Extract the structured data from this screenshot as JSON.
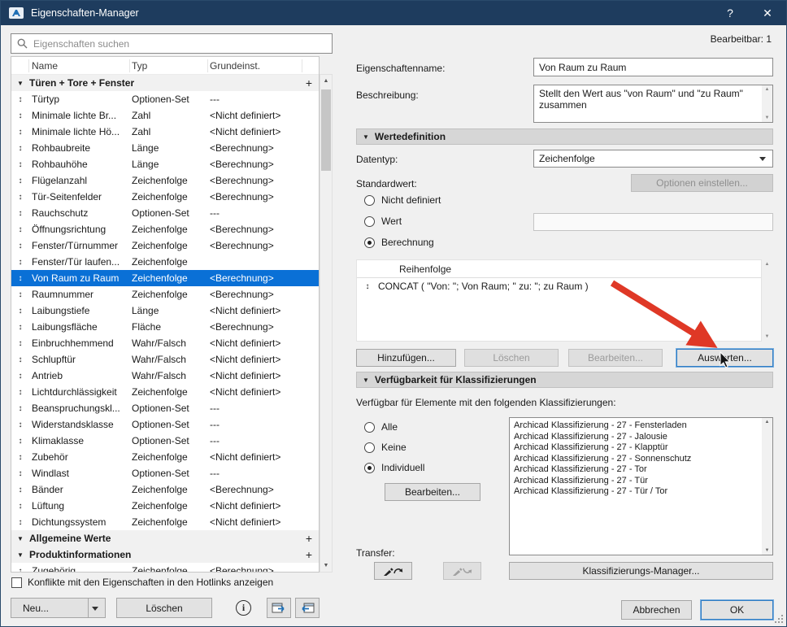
{
  "colors": {
    "titlebar": "#1e3c5e",
    "selection": "#0a70d6",
    "focus": "#2f7cc4",
    "annotation": "#df3826"
  },
  "icons": {
    "collapse": "▼",
    "drag": "↕",
    "plus": "+",
    "scroll_up": "▲",
    "scroll_down": "▼",
    "info": "i",
    "help": "?",
    "close": "✕"
  },
  "titlebar": {
    "title": "Eigenschaften-Manager"
  },
  "left_panel": {
    "search_placeholder": "Eigenschaften suchen",
    "columns": {
      "name": "Name",
      "typ": "Typ",
      "grund": "Grundeinst."
    },
    "rows": [
      {
        "type": "group",
        "name": "Türen + Tore + Fenster"
      },
      {
        "type": "item",
        "name": "Türtyp",
        "typ": "Optionen-Set",
        "grund": "---"
      },
      {
        "type": "item",
        "name": "Minimale lichte Br...",
        "typ": "Zahl",
        "grund": "<Nicht definiert>"
      },
      {
        "type": "item",
        "name": "Minimale lichte Hö...",
        "typ": "Zahl",
        "grund": "<Nicht definiert>"
      },
      {
        "type": "item",
        "name": "Rohbaubreite",
        "typ": "Länge",
        "grund": "<Berechnung>"
      },
      {
        "type": "item",
        "name": "Rohbauhöhe",
        "typ": "Länge",
        "grund": "<Berechnung>"
      },
      {
        "type": "item",
        "name": "Flügelanzahl",
        "typ": "Zeichenfolge",
        "grund": "<Berechnung>"
      },
      {
        "type": "item",
        "name": "Tür-Seitenfelder",
        "typ": "Zeichenfolge",
        "grund": "<Berechnung>"
      },
      {
        "type": "item",
        "name": "Rauchschutz",
        "typ": "Optionen-Set",
        "grund": "---"
      },
      {
        "type": "item",
        "name": "Öffnungsrichtung",
        "typ": "Zeichenfolge",
        "grund": "<Berechnung>"
      },
      {
        "type": "item",
        "name": "Fenster/Türnummer",
        "typ": "Zeichenfolge",
        "grund": "<Berechnung>"
      },
      {
        "type": "item",
        "name": "Fenster/Tür laufen...",
        "typ": "Zeichenfolge",
        "grund": ""
      },
      {
        "type": "item",
        "name": "Von Raum zu Raum",
        "typ": "Zeichenfolge",
        "grund": "<Berechnung>",
        "selected": true
      },
      {
        "type": "item",
        "name": "Raumnummer",
        "typ": "Zeichenfolge",
        "grund": "<Berechnung>"
      },
      {
        "type": "item",
        "name": "Laibungstiefe",
        "typ": "Länge",
        "grund": "<Nicht definiert>"
      },
      {
        "type": "item",
        "name": "Laibungsfläche",
        "typ": "Fläche",
        "grund": "<Berechnung>"
      },
      {
        "type": "item",
        "name": "Einbruchhemmend",
        "typ": "Wahr/Falsch",
        "grund": "<Nicht definiert>"
      },
      {
        "type": "item",
        "name": "Schlupftür",
        "typ": "Wahr/Falsch",
        "grund": "<Nicht definiert>"
      },
      {
        "type": "item",
        "name": "Antrieb",
        "typ": "Wahr/Falsch",
        "grund": "<Nicht definiert>"
      },
      {
        "type": "item",
        "name": "Lichtdurchlässigkeit",
        "typ": "Zeichenfolge",
        "grund": "<Nicht definiert>"
      },
      {
        "type": "item",
        "name": "Beanspruchungskl...",
        "typ": "Optionen-Set",
        "grund": "---"
      },
      {
        "type": "item",
        "name": "Widerstandsklasse",
        "typ": "Optionen-Set",
        "grund": "---"
      },
      {
        "type": "item",
        "name": "Klimaklasse",
        "typ": "Optionen-Set",
        "grund": "---"
      },
      {
        "type": "item",
        "name": "Zubehör",
        "typ": "Zeichenfolge",
        "grund": "<Nicht definiert>"
      },
      {
        "type": "item",
        "name": "Windlast",
        "typ": "Optionen-Set",
        "grund": "---"
      },
      {
        "type": "item",
        "name": "Bänder",
        "typ": "Zeichenfolge",
        "grund": "<Berechnung>"
      },
      {
        "type": "item",
        "name": "Lüftung",
        "typ": "Zeichenfolge",
        "grund": "<Nicht definiert>"
      },
      {
        "type": "item",
        "name": "Dichtungssystem",
        "typ": "Zeichenfolge",
        "grund": "<Nicht definiert>"
      },
      {
        "type": "group",
        "name": "Allgemeine Werte"
      },
      {
        "type": "group",
        "name": "Produktinformationen"
      },
      {
        "type": "item",
        "name": "Zugehörig...",
        "typ": "Zeichenfolge",
        "grund": "<Berechnung>"
      }
    ],
    "conflict_label": "Konflikte mit den Eigenschaften in den Hotlinks anzeigen",
    "new_button": "Neu...",
    "delete_button": "Löschen"
  },
  "right_panel": {
    "editable": "Bearbeitbar: 1",
    "name_label": "Eigenschaftenname:",
    "name_value": "Von Raum zu Raum",
    "desc_label": "Beschreibung:",
    "desc_value": "Stellt den Wert aus \"von Raum\" und \"zu Raum\" zusammen",
    "value_def": {
      "header": "Wertedefinition",
      "datatype_label": "Datentyp:",
      "datatype_value": "Zeichenfolge",
      "default_label": "Standardwert:",
      "options_button": "Optionen einstellen...",
      "radio_undefined": "Nicht definiert",
      "radio_value": "Wert",
      "radio_expression": "Berechnung",
      "expr_header": "Reihenfolge",
      "expr_value": "CONCAT ( \"Von: \"; Von Raum; \" zu: \"; zu Raum )",
      "add_button": "Hinzufügen...",
      "delete_button": "Löschen",
      "edit_button": "Bearbeiten...",
      "evaluate_button": "Auswerten..."
    },
    "availability": {
      "header": "Verfügbarkeit für Klassifizierungen",
      "intro": "Verfügbar für Elemente mit den folgenden Klassifizierungen:",
      "radio_all": "Alle",
      "radio_none": "Keine",
      "radio_custom": "Individuell",
      "edit_button": "Bearbeiten...",
      "classifications": [
        "Archicad Klassifizierung - 27 - Fensterladen",
        "Archicad Klassifizierung - 27 - Jalousie",
        "Archicad Klassifizierung - 27 - Klapptür",
        "Archicad Klassifizierung - 27 - Sonnenschutz",
        "Archicad Klassifizierung - 27 - Tor",
        "Archicad Klassifizierung - 27 - Tür",
        "Archicad Klassifizierung - 27 - Tür / Tor"
      ],
      "transfer_label": "Transfer:",
      "manager_button": "Klassifizierungs-Manager..."
    },
    "cancel_button": "Abbrechen",
    "ok_button": "OK"
  }
}
